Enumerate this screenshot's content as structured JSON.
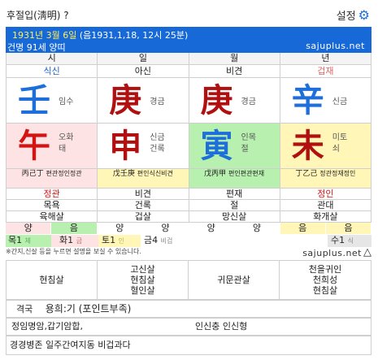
{
  "header": {
    "title": "후절입(淸明) ?",
    "settings_label": "설정",
    "settings_icon": "gear-icon"
  },
  "banner": {
    "date_prefix": "1931년 3월 6일",
    "date_detail": "(음1931,1,18, 12시 25분)",
    "person": "건명 91세 양띠",
    "site": "sajuplus.net"
  },
  "pillars": {
    "headers": [
      "시",
      "일",
      "월",
      "년"
    ],
    "sipsin_top": [
      "식신",
      "아신",
      "비견",
      "겁재"
    ],
    "stems": [
      {
        "char": "壬",
        "label": "임수",
        "color": "#1e6fd9",
        "bg": "#ffffff"
      },
      {
        "char": "庚",
        "label": "경금",
        "color": "#b01010",
        "bg": "#ffffff"
      },
      {
        "char": "庚",
        "label": "경금",
        "color": "#b01010",
        "bg": "#ffffff"
      },
      {
        "char": "辛",
        "label": "신금",
        "color": "#1e6fd9",
        "bg": "#ffffff"
      }
    ],
    "branches": [
      {
        "char": "午",
        "label1": "오화",
        "label2": "태",
        "color": "#d41313",
        "bg": "#fde3e3"
      },
      {
        "char": "申",
        "label1": "신금",
        "label2": "건록",
        "color": "#b01010",
        "bg": "#ffffff"
      },
      {
        "char": "寅",
        "label1": "인목",
        "label2": "절",
        "color": "#1e6fd9",
        "bg": "#b8f0b0"
      },
      {
        "char": "未",
        "label1": "미토",
        "label2": "쇠",
        "color": "#b01010",
        "bg": "#fff6b8"
      }
    ],
    "hidden_stems": [
      "丙己丁",
      "戊壬庚",
      "戊丙甲",
      "丁乙己"
    ],
    "hidden_sipsin": [
      "편관정인정관",
      "편인식신비견",
      "편인편관편재",
      "정관정재정인"
    ],
    "sipsin_bottom": [
      "정관",
      "비견",
      "편재",
      "정인"
    ],
    "unseong": [
      "목욕",
      "건록",
      "절",
      "관대"
    ],
    "sinsal": [
      "육해살",
      "겁살",
      "망신살",
      "화개살"
    ]
  },
  "yinyang": [
    "양",
    "음",
    "양",
    "양",
    "양",
    "양",
    "음",
    "음"
  ],
  "elements": [
    {
      "name": "목1",
      "mark": "체",
      "bg": "#b8f0b0"
    },
    {
      "name": "화1",
      "mark": "금",
      "bg": "#fde3e3"
    },
    {
      "name": "토1",
      "mark": "인",
      "bg": "#fff6b8"
    },
    {
      "name": "금4",
      "mark": "비겁",
      "bg": "#ffffff"
    },
    {
      "name": "수1",
      "mark": "식",
      "bg": "#e6e6e6"
    }
  ],
  "notice": "※간지,신살 등을 누르면 설명을 보실 수 있습니다.",
  "site_footer": "sajuplus.net",
  "sinsal_box": [
    [
      "현침살"
    ],
    [
      "고신살",
      "현침살",
      "혈인살"
    ],
    [
      "귀문관살"
    ],
    [
      "천을귀인",
      "천희성",
      "현침살"
    ]
  ],
  "gyeokguk": {
    "label": "격국",
    "value": "용희:기 (포인트부족)"
  },
  "hap": {
    "left": "정임명암,갑기암합,",
    "right": "인신충 인신형"
  },
  "footer_text": "경경병존 일주간여지동 비겁과다"
}
